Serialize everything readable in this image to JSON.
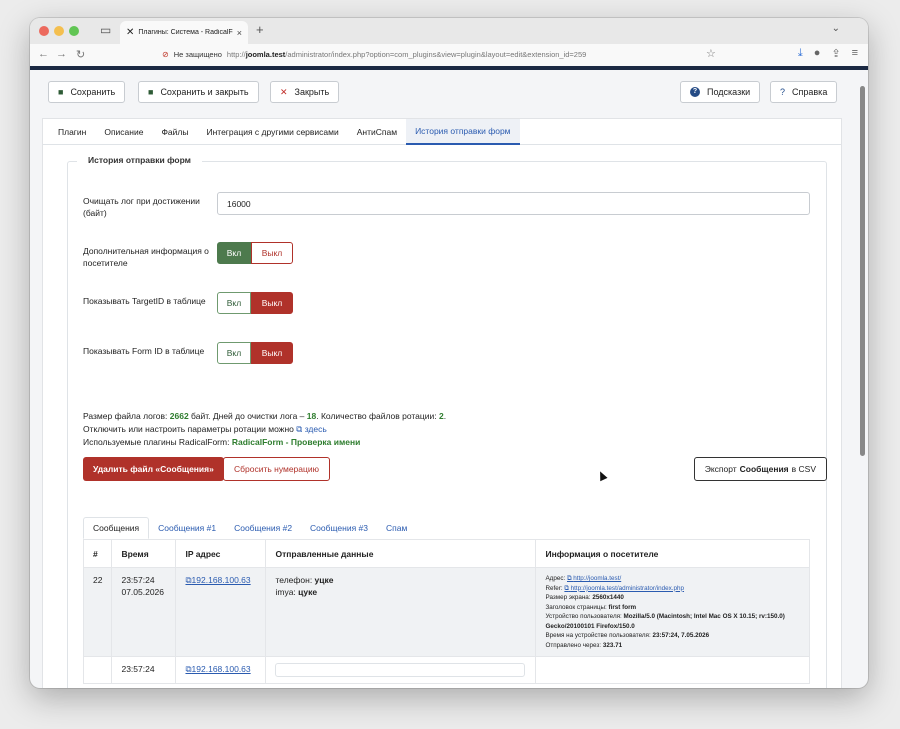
{
  "browser": {
    "tab_title": "Плагины: Система - RadicalFo",
    "tab_close": "×",
    "new_tab": "+",
    "security": "Не защищено",
    "url_prefix": "http://",
    "url_host": "joomla.test",
    "url_path": "/administrator/index.php?option=com_plugins&view=plugin&layout=edit&extension_id=259"
  },
  "toolbar": {
    "save": "Сохранить",
    "save_close": "Сохранить и закрыть",
    "close": "Закрыть",
    "hints": "Подсказки",
    "help": "Справка"
  },
  "tabs": [
    "Плагин",
    "Описание",
    "Файлы",
    "Интеграция с другими сервисами",
    "АнтиСпам",
    "История отправки форм"
  ],
  "form": {
    "legend": "История отправки форм",
    "clear_log_label": "Очищать лог при достижении (байт)",
    "clear_log_value": "16000",
    "extra_info_label": "Дополнительная информация о посетителе",
    "target_id_label": "Показывать TargetID в таблице",
    "form_id_label": "Показывать Form ID в таблице",
    "on": "Вкл",
    "off": "Выкл"
  },
  "info": {
    "line1_a": "Размер файла логов: ",
    "size": "2662",
    "line1_b": " байт. Дней до очистки лога – ",
    "days": "18",
    "line1_c": ". Количество файлов ротации: ",
    "files": "2",
    "line1_d": ".",
    "line2_a": "Отключить или настроить параметры ротации можно ",
    "line2_link": "здесь",
    "line3_a": "Используемые плагины RadicalForm: ",
    "line3_plugin": "RadicalForm - Проверка имени"
  },
  "buttons": {
    "delete": "Удалить файл «Сообщения»",
    "reset": "Сбросить нумерацию",
    "export_a": "Экспорт",
    "export_b": "Сообщения",
    "export_c": "в CSV"
  },
  "subtabs": [
    "Сообщения",
    "Сообщения #1",
    "Сообщения #2",
    "Сообщения #3",
    "Спам"
  ],
  "table": {
    "headers": [
      "#",
      "Время",
      "IP адрес",
      "Отправленные данные",
      "Информация о посетителе"
    ],
    "row1": {
      "num": "22",
      "time1": "23:57:24",
      "time2": "07.05.2026",
      "ip": "192.168.100.63",
      "data1_key": "телефон: ",
      "data1_val": "уцке",
      "data2_key": "imya: ",
      "data2_val": "цуке",
      "addr_label": "Адрес: ",
      "addr": "http://joomla.test/",
      "refer_label": "Refer: ",
      "refer": "http://joomla.test/administrator/index.php",
      "screen_label": "Размер экрана: ",
      "screen": "2560x1440",
      "title_label": "Заголовок страницы: ",
      "title": "first form",
      "ua_label": "Устройство пользователя: ",
      "ua": "Mozilla/5.0 (Macintosh; Intel Mac OS X 10.15; rv:150.0) Gecko/20100101 Firefox/150.0",
      "time_label": "Время на устройстве пользователя: ",
      "device_time": "23:57:24, 7.05.2026",
      "sent_label": "Отправлено через: ",
      "sent": "323.71"
    },
    "row2": {
      "time1": "23:57:24",
      "ip": "192.168.100.63"
    }
  }
}
